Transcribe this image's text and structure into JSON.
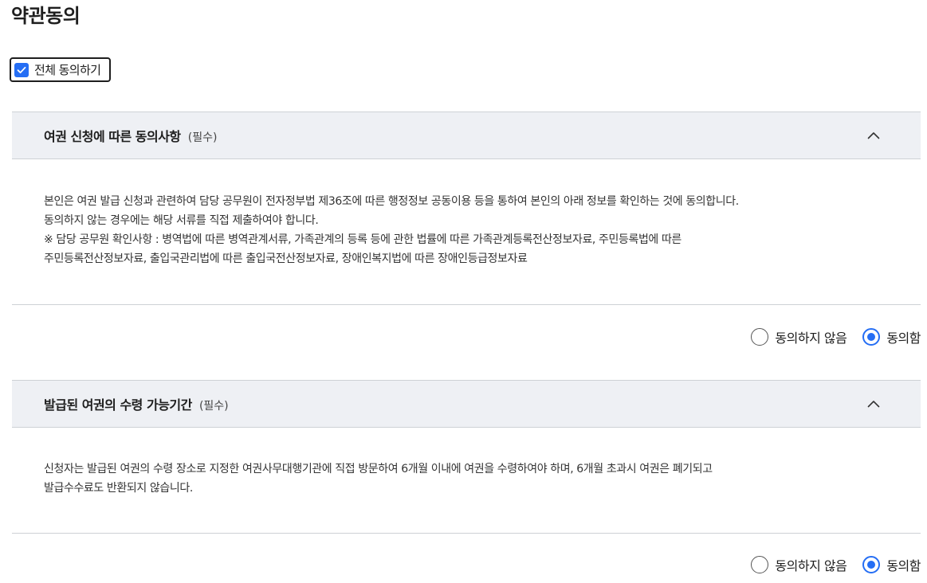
{
  "page": {
    "title": "약관동의"
  },
  "agree_all": {
    "label": "전체 동의하기",
    "checked": true
  },
  "sections": [
    {
      "title": "여권 신청에 따른 동의사항",
      "required": "(필수)",
      "expanded": true,
      "lines": [
        "본인은 여권 발급 신청과 관련하여 담당 공무원이 전자정부법 제36조에 따른 행정정보 공동이용 등을 통하여 본인의 아래 정보를 확인하는 것에 동의합니다.",
        "동의하지 않는 경우에는 해당 서류를 직접 제출하여야 합니다.",
        "※ 담당 공무원 확인사항 : 병역법에 따른 병역관계서류, 가족관계의 등록 등에 관한 법률에 따른 가족관계등록전산정보자료, 주민등록법에 따른",
        "주민등록전산정보자료, 출입국관리법에 따른 출입국전산정보자료, 장애인복지법에 따른 장애인등급정보자료"
      ],
      "options": [
        {
          "label": "동의하지 않음",
          "selected": false
        },
        {
          "label": "동의함",
          "selected": true
        }
      ]
    },
    {
      "title": "발급된 여권의 수령 가능기간",
      "required": "(필수)",
      "expanded": true,
      "lines": [
        "신청자는 발급된 여권의 수령 장소로 지정한 여권사무대행기관에 직접 방문하여 6개월 이내에 여권을 수령하여야 하며, 6개월 초과시 여권은 폐기되고",
        "발급수수료도 반환되지 않습니다."
      ],
      "options": [
        {
          "label": "동의하지 않음",
          "selected": false
        },
        {
          "label": "동의함",
          "selected": true
        }
      ]
    }
  ],
  "colors": {
    "accent": "#256ef4",
    "header_bg": "#eef0f4",
    "border": "#cdd1d5"
  },
  "icons": {
    "check": "check-icon",
    "collapse": "chevron-up-icon"
  }
}
